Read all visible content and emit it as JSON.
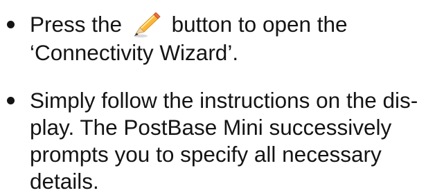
{
  "instructions": {
    "step1": {
      "before_icon": "Press the",
      "icon": "pencil-icon",
      "after_icon": "button to open the",
      "line2": "‘Connectivity Wizard’."
    },
    "step2": {
      "lines": [
        "Simply follow the instructions on the dis-",
        "play. The PostBase Mini successively",
        "prompts you to specify all necessary",
        "details."
      ]
    }
  }
}
